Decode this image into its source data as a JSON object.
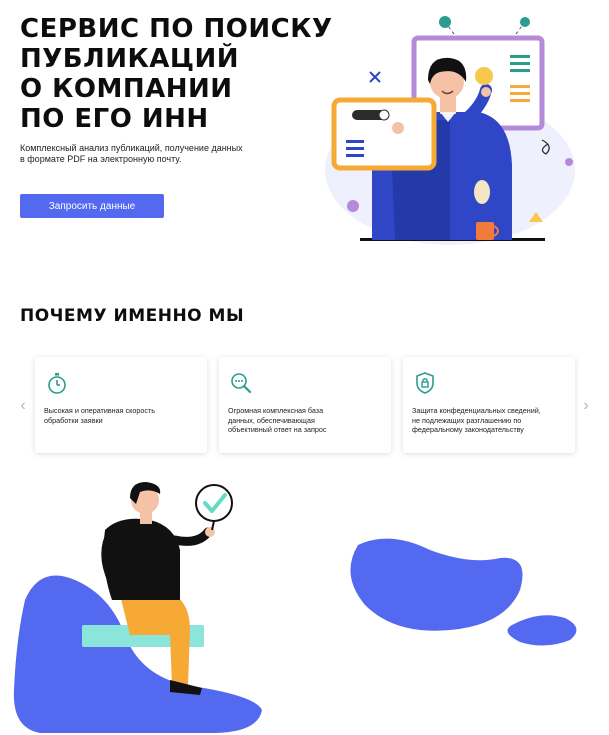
{
  "hero": {
    "title_lines": [
      "СЕРВИС ПО ПОИСКУ",
      "ПУБЛИКАЦИЙ",
      "О КОМПАНИИ",
      "ПО ЕГО ИНН"
    ],
    "subtitle_lines": [
      "Комплексный анализ публикаций, получение данных",
      "в формате PDF на электронную почту."
    ],
    "cta_label": "Запросить данные",
    "illustration": "man-at-screens-illustration"
  },
  "why": {
    "title": "ПОЧЕМУ ИМЕННО МЫ",
    "prev_arrow": "‹",
    "next_arrow": "›",
    "cards": [
      {
        "icon": "stopwatch-icon",
        "lines": [
          "Высокая и оперативная скорость",
          "обработки заявки"
        ]
      },
      {
        "icon": "chat-search-icon",
        "lines": [
          "Огромная комплексная база",
          "данных, обеспечивающая",
          "объективный ответ на запрос"
        ]
      },
      {
        "icon": "shield-lock-icon",
        "lines": [
          "Защита конфеденциальных сведений,",
          "не подлежащих разглашению по",
          "федеральному законодательству"
        ]
      }
    ]
  },
  "colors": {
    "accent": "#5369f0",
    "teal": "#2a9d8f",
    "orange": "#f7a936",
    "purple": "#b58ad9",
    "dark": "#0d0d0d"
  }
}
